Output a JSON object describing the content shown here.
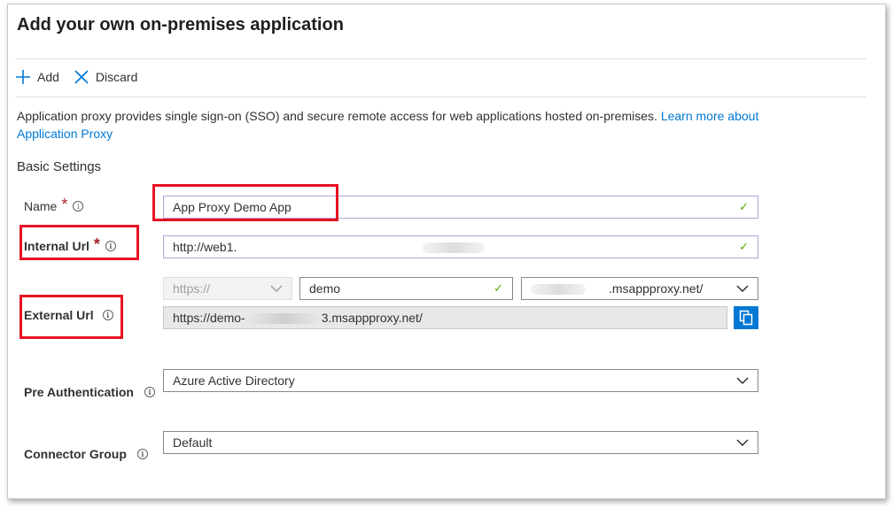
{
  "header": {
    "title": "Add your own on-premises application"
  },
  "toolbar": {
    "add_label": "Add",
    "discard_label": "Discard"
  },
  "description": {
    "text": "Application proxy provides single sign-on (SSO) and secure remote access for web applications hosted on-premises. ",
    "link_text": "Learn more about Application Proxy"
  },
  "section": {
    "title": "Basic Settings"
  },
  "form": {
    "name": {
      "label": "Name",
      "value": "App Proxy Demo App"
    },
    "internal_url": {
      "label": "Internal Url",
      "value": "http://web1."
    },
    "external_url": {
      "label": "External Url",
      "protocol": "https://",
      "subdomain": "demo",
      "domain_suffix": ".msappproxy.net/",
      "full_prefix": "https://demo-",
      "full_suffix": "3.msappproxy.net/"
    },
    "pre_authentication": {
      "label": "Pre Authentication",
      "value": "Azure Active Directory"
    },
    "connector_group": {
      "label": "Connector Group",
      "value": "Default"
    }
  },
  "colors": {
    "accent": "#0078d4",
    "required": "#a4262c",
    "valid_check": "#57a300",
    "highlight_box": "#e81123"
  }
}
